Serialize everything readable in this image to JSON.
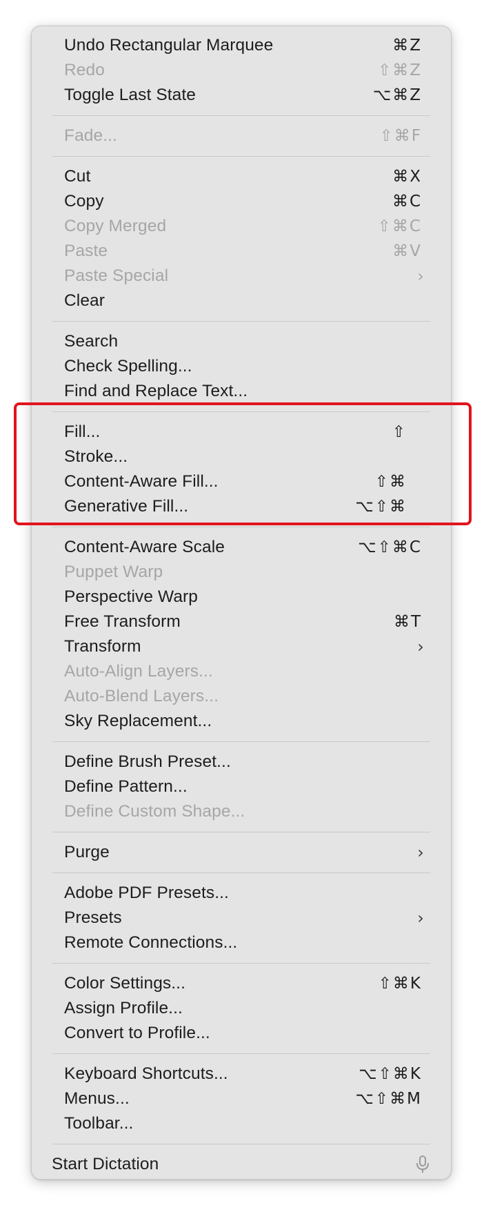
{
  "menu": {
    "sections": [
      {
        "items": [
          {
            "label": "Undo Rectangular Marquee",
            "shortcut": "⌘Z",
            "disabled": false
          },
          {
            "label": "Redo",
            "shortcut": "⇧⌘Z",
            "disabled": true
          },
          {
            "label": "Toggle Last State",
            "shortcut": "⌥⌘Z",
            "disabled": false
          }
        ]
      },
      {
        "items": [
          {
            "label": "Fade...",
            "shortcut": "⇧⌘F",
            "disabled": true
          }
        ]
      },
      {
        "items": [
          {
            "label": "Cut",
            "shortcut": "⌘X",
            "disabled": false
          },
          {
            "label": "Copy",
            "shortcut": "⌘C",
            "disabled": false
          },
          {
            "label": "Copy Merged",
            "shortcut": "⇧⌘C",
            "disabled": true
          },
          {
            "label": "Paste",
            "shortcut": "⌘V",
            "disabled": true
          },
          {
            "label": "Paste Special",
            "submenu": true,
            "disabled": true
          },
          {
            "label": "Clear",
            "disabled": false
          }
        ]
      },
      {
        "items": [
          {
            "label": "Search",
            "disabled": false
          },
          {
            "label": "Check Spelling...",
            "disabled": false
          },
          {
            "label": "Find and Replace Text...",
            "disabled": false
          }
        ]
      },
      {
        "items": [
          {
            "label": "Fill...",
            "shortcut": "⇧",
            "disabled": false,
            "narrow": true
          },
          {
            "label": "Stroke...",
            "disabled": false
          },
          {
            "label": "Content-Aware Fill...",
            "shortcut": "⇧⌘",
            "disabled": false,
            "narrow": true
          },
          {
            "label": "Generative Fill...",
            "shortcut": "⌥⇧⌘",
            "disabled": false,
            "narrow": true
          }
        ]
      },
      {
        "items": [
          {
            "label": "Content-Aware Scale",
            "shortcut": "⌥⇧⌘C",
            "disabled": false
          },
          {
            "label": "Puppet Warp",
            "disabled": true
          },
          {
            "label": "Perspective Warp",
            "disabled": false
          },
          {
            "label": "Free Transform",
            "shortcut": "⌘T",
            "disabled": false
          },
          {
            "label": "Transform",
            "submenu": true,
            "disabled": false
          },
          {
            "label": "Auto-Align Layers...",
            "disabled": true
          },
          {
            "label": "Auto-Blend Layers...",
            "disabled": true
          },
          {
            "label": "Sky Replacement...",
            "disabled": false
          }
        ]
      },
      {
        "items": [
          {
            "label": "Define Brush Preset...",
            "disabled": false
          },
          {
            "label": "Define Pattern...",
            "disabled": false
          },
          {
            "label": "Define Custom Shape...",
            "disabled": true
          }
        ]
      },
      {
        "items": [
          {
            "label": "Purge",
            "submenu": true,
            "disabled": false
          }
        ]
      },
      {
        "items": [
          {
            "label": "Adobe PDF Presets...",
            "disabled": false
          },
          {
            "label": "Presets",
            "submenu": true,
            "disabled": false
          },
          {
            "label": "Remote Connections...",
            "disabled": false
          }
        ]
      },
      {
        "items": [
          {
            "label": "Color Settings...",
            "shortcut": "⇧⌘K",
            "disabled": false
          },
          {
            "label": "Assign Profile...",
            "disabled": false
          },
          {
            "label": "Convert to Profile...",
            "disabled": false
          }
        ]
      },
      {
        "items": [
          {
            "label": "Keyboard Shortcuts...",
            "shortcut": "⌥⇧⌘K",
            "disabled": false
          },
          {
            "label": "Menus...",
            "shortcut": "⌥⇧⌘M",
            "disabled": false
          },
          {
            "label": "Toolbar...",
            "disabled": false
          }
        ]
      }
    ],
    "dictation": {
      "label": "Start Dictation",
      "icon": "microphone-icon"
    },
    "submenu_glyph": "›"
  },
  "highlight": {
    "color": "#e0141e",
    "target_section": "fill-group"
  },
  "colors": {
    "menu_background": "#e4e4e4",
    "text": "#1d1d1d",
    "disabled_text": "#a6a6a6",
    "separator": "#c9c9c9"
  }
}
